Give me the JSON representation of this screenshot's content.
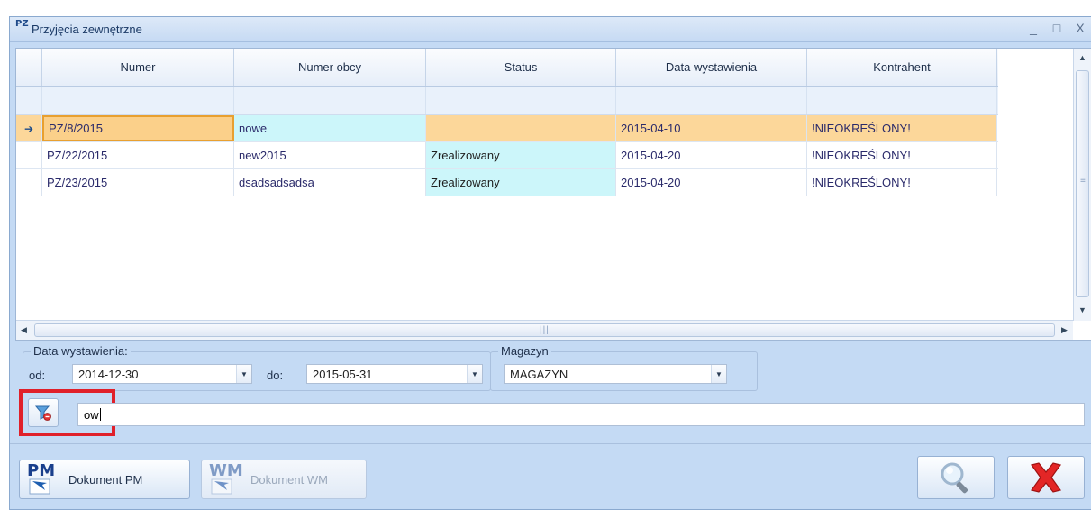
{
  "window": {
    "icon_text": "PZ",
    "title": "Przyjęcia zewnętrzne",
    "controls": [
      "_",
      "□",
      "X"
    ]
  },
  "grid": {
    "columns": [
      "Numer",
      "Numer obcy",
      "Status",
      "Data wystawienia",
      "Kontrahent"
    ],
    "rows": [
      {
        "numer": "PZ/8/2015",
        "numer_obcy": "nowe",
        "status": "",
        "data": "2015-04-10",
        "kontrahent": "!NIEOKREŚLONY!",
        "selected": true
      },
      {
        "numer": "PZ/22/2015",
        "numer_obcy": "new2015",
        "status": "Zrealizowany",
        "data": "2015-04-20",
        "kontrahent": "!NIEOKREŚLONY!",
        "selected": false
      },
      {
        "numer": "PZ/23/2015",
        "numer_obcy": "dsadsadsadsa",
        "status": "Zrealizowany",
        "data": "2015-04-20",
        "kontrahent": "!NIEOKREŚLONY!",
        "selected": false
      }
    ],
    "row_indicator": "➔"
  },
  "filters": {
    "date_group_label": "Data wystawienia:",
    "od_label": "od:",
    "od_value": "2014-12-30",
    "do_label": "do:",
    "do_value": "2015-05-31",
    "magazyn_group_label": "Magazyn",
    "magazyn_value": "MAGAZYN"
  },
  "search": {
    "value": "ow"
  },
  "buttons": {
    "pm_code": "PM",
    "pm_label": "Dokument PM",
    "wm_code": "WM",
    "wm_label": "Dokument WM"
  },
  "colors": {
    "accent_highlight": "#e0202a",
    "selected_row": "#fcd79a",
    "status_column": "#ccf6fa"
  }
}
